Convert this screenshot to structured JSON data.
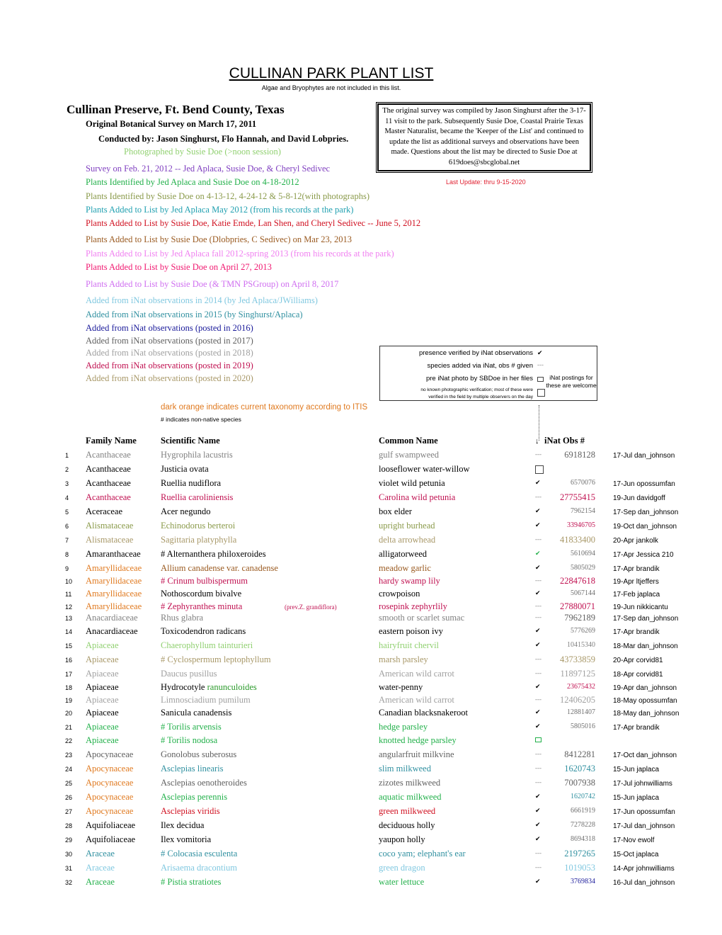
{
  "header": {
    "title": "CULLINAN PARK PLANT LIST",
    "subtitle": "Algae and Bryophytes are not included in this list.",
    "location": "Cullinan Preserve, Ft. Bend County, Texas",
    "original_survey": "Original Botanical Survey on March 17, 2011",
    "conducted_by": "Conducted by: Jason Singhurst, Flo Hannah, and David Lobpries.",
    "photographed_by": "Photographed by Susie Doe (>noon session)",
    "survey_2012": "Survey on Feb. 21, 2012 -- Jed Aplaca, Susie Doe, & Cheryl Sedivec"
  },
  "info_box": "The original survey was compiled by Jason Singhurst after the 3-17-11 visit to the park.   Subsequently Susie Doe, Coastal Prairie Texas Master Naturalist, became the 'Keeper of the List' and continued to update the list as additional surveys and observations have been made.   Questions about the list may be directed to Susie Doe at 619does@sbcglobal.net",
  "last_update": "Last Update: thru 9-15-2020",
  "color_key": [
    {
      "text": "Plants Identified by Jed Aplaca and Susie Doe on 4-18-2012",
      "color": "#22b04a"
    },
    {
      "text": "Plants Identified by Susie Doe on 4-13-12, 4-24-12 & 5-8-12(with photographs)",
      "color": "#8a9a4a"
    },
    {
      "text": "Plants Added to List by Jed Aplaca May 2012 (from his records at the park)",
      "color": "#20a0b0"
    },
    {
      "text": "Plants Added to List by Susie Doe, Katie Emde, Lan Shen, and Cheryl Sedivec -- June 5, 2012",
      "color": "#d01020"
    },
    {
      "text": "Plants Added to List by Susie Doe (Dlobpries, C Sedivec) on Mar 23, 2013",
      "color": "#9a5a20"
    },
    {
      "text": "Plants Added to List by Jed Aplaca fall 2012-spring 2013  (from his records at the park)",
      "color": "#f080f0"
    },
    {
      "text": "Plants Added to List by Susie Doe on April 27, 2013",
      "color": "#f01870"
    },
    {
      "text": "Plants Added to List by Susie Doe (& TMN PSGroup) on April 8, 2017",
      "color": "#d070f0"
    },
    {
      "text": "Added from iNat observations    in 2014 (by Jed Aplaca/JWilliams)",
      "color": "#80c8e0"
    },
    {
      "text": "Added from iNat observations    in 2015 (by Singhurst/Aplaca)",
      "color": "#3090a0"
    },
    {
      "text": "Added from iNat observations  (posted in 2016)",
      "color": "#1a1a9a"
    },
    {
      "text": "Added from iNat observations  (posted in 2017)",
      "color": "#606060"
    },
    {
      "text": "Added from iNat observations  (posted in 2018)",
      "color": "#a0a0a0"
    },
    {
      "text": "Added from iNat observations  (posted in 2019)",
      "color": "#c01050"
    },
    {
      "text": "Added from iNat observations  (posted in 2020)",
      "color": "#a89868"
    }
  ],
  "legend": {
    "verified": "presence verified by iNat observations",
    "added_via_inat": "species added via iNat, obs # given",
    "pre_inat_photo": "pre iNat photo by SBDoe in her files",
    "no_verification_1": "no known photographic verification; most of these were",
    "no_verification_2": "verified in the field by multiple observers on the day",
    "welcome": "iNat postings for these are welcome",
    "check_symbol": "✔",
    "dash_symbol": "---"
  },
  "notes": {
    "dark_orange": "dark orange indicates current taxonomy according to ITIS",
    "non_native": "# indicates non-native species"
  },
  "table": {
    "headers": {
      "family": "Family Name",
      "scientific": "Scientific Name",
      "common": "Common Name",
      "arrow": "↓",
      "obs": "iNat Obs #"
    },
    "rows": [
      {
        "n": "1",
        "family": "Acanthaceae",
        "scientific": "Hygrophila lacustris",
        "prev": "",
        "common": "gulf swampweed",
        "mark": "dash",
        "obs": "6918128",
        "date": "17-Jul",
        "user": "dan_johnson",
        "famColor": "#808080",
        "sciColor": "#808080",
        "comColor": "#808080",
        "obsColor": "#606060",
        "obsSize": "big"
      },
      {
        "n": "2",
        "family": "Acanthaceae",
        "scientific": "Justicia ovata",
        "prev": "",
        "common": "looseflower water-willow",
        "mark": "box",
        "obs": "",
        "date": "",
        "user": "",
        "famColor": "#000",
        "sciColor": "#000",
        "comColor": "#000",
        "obsColor": "#000",
        "obsSize": "big"
      },
      {
        "n": "3",
        "family": "Acanthaceae",
        "scientific": "Ruellia nudiflora",
        "prev": "",
        "common": "violet wild petunia",
        "mark": "check",
        "obs": "6570076",
        "date": "17-Jun",
        "user": "opossumfan",
        "famColor": "#000",
        "sciColor": "#000",
        "comColor": "#000",
        "obsColor": "#707070",
        "obsSize": "small"
      },
      {
        "n": "4",
        "family": "Acanthaceae",
        "scientific": "Ruellia caroliniensis",
        "prev": "",
        "common": "Carolina wild petunia",
        "mark": "dash",
        "obs": "27755415",
        "date": "19-Jun",
        "user": "davidgoff",
        "famColor": "#c01050",
        "sciColor": "#c01050",
        "comColor": "#c01050",
        "obsColor": "#c01050",
        "obsSize": "big"
      },
      {
        "n": "5",
        "family": "Aceraceae",
        "scientific": "Acer negundo",
        "prev": "",
        "common": "box elder",
        "mark": "check",
        "obs": "7962154",
        "date": "17-Sep",
        "user": "dan_johnson",
        "famColor": "#000",
        "sciColor": "#000",
        "comColor": "#000",
        "obsColor": "#707070",
        "obsSize": "small"
      },
      {
        "n": "6",
        "family": "Alismataceae",
        "scientific": "Echinodorus berteroi",
        "prev": "",
        "common": "upright burhead",
        "mark": "check",
        "obs": "33946705",
        "date": "19-Oct",
        "user": "dan_johnson",
        "famColor": "#8a9a4a",
        "sciColor": "#8a9a4a",
        "comColor": "#8a9a4a",
        "obsColor": "#c01050",
        "obsSize": "small"
      },
      {
        "n": "7",
        "family": "Alismataceae",
        "scientific": "Sagittaria platyphylla",
        "prev": "",
        "common": "delta arrowhead",
        "mark": "dash",
        "obs": "41833400",
        "date": "20-Apr",
        "user": "jankolk",
        "famColor": "#a89868",
        "sciColor": "#a89868",
        "comColor": "#a89868",
        "obsColor": "#a89868",
        "obsSize": "big"
      },
      {
        "n": "8",
        "family": "Amaranthaceae",
        "scientific": "# Alternanthera philoxeroides",
        "prev": "",
        "common": "alligatorweed",
        "mark": "check-green",
        "obs": "5610694",
        "date": "17-Apr",
        "user": "Jessica 210",
        "famColor": "#000",
        "sciColor": "#000",
        "comColor": "#000",
        "obsColor": "#707070",
        "obsSize": "small"
      },
      {
        "n": "9",
        "family": "Amaryllidaceae",
        "scientific": "Allium canadense var. canadense",
        "prev": "",
        "common": "meadow garlic",
        "mark": "check",
        "obs": "5805029",
        "date": "17-Apr",
        "user": "brandik",
        "famColor": "#e07a20",
        "sciColor": "#9a5a20",
        "comColor": "#9a5a20",
        "obsColor": "#707070",
        "obsSize": "small"
      },
      {
        "n": "10",
        "family": "Amaryllidaceae",
        "scientific": "# Crinum bulbispermum",
        "prev": "",
        "common": "hardy swamp lily",
        "mark": "dash",
        "obs": "22847618",
        "date": "19-Apr",
        "user": "ltjeffers",
        "famColor": "#e07a20",
        "sciColor": "#c01050",
        "comColor": "#c01050",
        "obsColor": "#c01050",
        "obsSize": "big"
      },
      {
        "n": "11",
        "family": "Amaryllidaceae",
        "scientific": "Nothoscordum bivalve",
        "prev": "",
        "common": "crowpoison",
        "mark": "check",
        "obs": "5067144",
        "date": "17-Feb",
        "user": "japlaca",
        "famColor": "#e07a20",
        "sciColor": "#000",
        "comColor": "#000",
        "obsColor": "#707070",
        "obsSize": "small"
      },
      {
        "n": "12",
        "family": "Amaryllidaceae",
        "scientific": "# Zephyranthes minuta",
        "prev": "(prev.Z. grandiflora)",
        "common": "rosepink zephyrlily",
        "mark": "dash",
        "obs": "27880071",
        "date": "19-Jun",
        "user": "nikkicantu",
        "famColor": "#e07a20",
        "sciColor": "#c01050",
        "comColor": "#c01050",
        "obsColor": "#c01050",
        "obsSize": "big"
      },
      {
        "n": "13",
        "family": "Anacardiaceae",
        "scientific": "Rhus glabra",
        "prev": "",
        "common": "smooth or scarlet sumac",
        "mark": "dash",
        "obs": "7962189",
        "date": "17-Sep",
        "user": "dan_johnson",
        "famColor": "#808080",
        "sciColor": "#808080",
        "comColor": "#808080",
        "obsColor": "#606060",
        "obsSize": "big"
      },
      {
        "n": "14",
        "family": "Anacardiaceae",
        "scientific": "Toxicodendron radicans",
        "prev": "",
        "common": "eastern poison ivy",
        "mark": "check",
        "obs": "5776269",
        "date": "17-Apr",
        "user": "brandik",
        "famColor": "#000",
        "sciColor": "#000",
        "comColor": "#000",
        "obsColor": "#707070",
        "obsSize": "small"
      },
      {
        "n": "15",
        "family": "Apiaceae",
        "scientific": "Chaerophyllum tainturieri",
        "prev": "",
        "common": "hairyfruit chervil",
        "mark": "check",
        "obs": "10415340",
        "date": "18-Mar",
        "user": "dan_johnson",
        "famColor": "#90d070",
        "sciColor": "#90d070",
        "comColor": "#90d070",
        "obsColor": "#808080",
        "obsSize": "small"
      },
      {
        "n": "16",
        "family": "Apiaceae",
        "scientific": "# Cyclospermum leptophyllum",
        "prev": "",
        "common": "marsh parsley",
        "mark": "dash",
        "obs": "43733859",
        "date": "20-Apr",
        "user": "corvid81",
        "famColor": "#a89868",
        "sciColor": "#a89868",
        "comColor": "#a89868",
        "obsColor": "#a89868",
        "obsSize": "big"
      },
      {
        "n": "17",
        "family": "Apiaceae",
        "scientific": "Daucus pusillus",
        "prev": "",
        "common": "American wild carrot",
        "mark": "dash",
        "obs": "11897125",
        "date": "18-Apr",
        "user": "corvid81",
        "famColor": "#a0a0a0",
        "sciColor": "#a0a0a0",
        "comColor": "#a0a0a0",
        "obsColor": "#a0a0a0",
        "obsSize": "big"
      },
      {
        "n": "18",
        "family": "Apiaceae",
        "scientific": "Hydrocotyle ",
        "sciExtra": "ranunculoides",
        "prev": "",
        "common": "water-penny",
        "mark": "check",
        "obs": "23675432",
        "date": "19-Apr",
        "user": "dan_johnson",
        "famColor": "#000",
        "sciColor": "#000",
        "sciExtraColor": "#2a9a2a",
        "comColor": "#000",
        "obsColor": "#c01050",
        "obsSize": "small"
      },
      {
        "n": "19",
        "family": "Apiaceae",
        "scientific": "Limnosciadium pumilum",
        "prev": "",
        "common": "American wild carrot",
        "mark": "dash",
        "obs": "12406205",
        "date": "18-May",
        "user": "opossumfan",
        "famColor": "#a0a0a0",
        "sciColor": "#a0a0a0",
        "comColor": "#a0a0a0",
        "obsColor": "#a0a0a0",
        "obsSize": "big"
      },
      {
        "n": "20",
        "family": "Apiaceae",
        "scientific": "Sanicula canadensis",
        "prev": "",
        "common": "Canadian blacksnakeroot",
        "mark": "check",
        "obs": "12881407",
        "date": "18-May",
        "user": "dan_johnson",
        "famColor": "#000",
        "sciColor": "#000",
        "comColor": "#000",
        "obsColor": "#707070",
        "obsSize": "small"
      },
      {
        "n": "21",
        "family": "Apiaceae",
        "scientific": "# Torilis arvensis",
        "prev": "",
        "common": "hedge parsley",
        "mark": "check",
        "obs": "5805016",
        "date": "17-Apr",
        "user": "brandik",
        "famColor": "#22b04a",
        "sciColor": "#22b04a",
        "comColor": "#22b04a",
        "obsColor": "#707070",
        "obsSize": "small"
      },
      {
        "n": "22",
        "family": "Apiaceae",
        "scientific": "# Torilis nodosa",
        "prev": "",
        "common": "knotted hedge parsley",
        "mark": "photo",
        "obs": "",
        "date": "",
        "user": "",
        "famColor": "#22b04a",
        "sciColor": "#22b04a",
        "comColor": "#22b04a",
        "obsColor": "#000",
        "obsSize": "big"
      },
      {
        "n": "23",
        "family": "Apocynaceae",
        "scientific": "Gonolobus suberosus",
        "prev": "",
        "common": "angularfruit milkvine",
        "mark": "dash",
        "obs": "8412281",
        "date": "17-Oct",
        "user": "dan_johnson",
        "famColor": "#606060",
        "sciColor": "#606060",
        "comColor": "#606060",
        "obsColor": "#606060",
        "obsSize": "big"
      },
      {
        "n": "24",
        "family": "Apocynaceae",
        "scientific": "Asclepias linearis",
        "prev": "",
        "common": "slim milkweed",
        "mark": "dash",
        "obs": "1620743",
        "date": "15-Jun",
        "user": "japlaca",
        "famColor": "#e07a20",
        "sciColor": "#3090a0",
        "comColor": "#3090a0",
        "obsColor": "#3090a0",
        "obsSize": "big"
      },
      {
        "n": "25",
        "family": "Apocynaceae",
        "scientific": "Asclepias oenotheroides",
        "prev": "",
        "common": "zizotes milkweed",
        "mark": "dash",
        "obs": "7007938",
        "date": "17-Jul",
        "user": "johnwilliams",
        "famColor": "#e07a20",
        "sciColor": "#606060",
        "comColor": "#606060",
        "obsColor": "#606060",
        "obsSize": "big"
      },
      {
        "n": "26",
        "family": "Apocynaceae",
        "scientific": "Asclepias perennis",
        "prev": "",
        "common": "aquatic milkweed",
        "mark": "check",
        "obs": "1620742",
        "date": "15-Jun",
        "user": "japlaca",
        "famColor": "#e07a20",
        "sciColor": "#22b04a",
        "comColor": "#22b04a",
        "obsColor": "#3090a0",
        "obsSize": "small"
      },
      {
        "n": "27",
        "family": "Apocynaceae",
        "scientific": "Asclepias viridis",
        "prev": "",
        "common": "green milkweed",
        "mark": "check",
        "obs": "6661919",
        "date": "17-Jun",
        "user": "opossumfan",
        "famColor": "#e07a20",
        "sciColor": "#d01020",
        "comColor": "#d01020",
        "obsColor": "#707070",
        "obsSize": "small"
      },
      {
        "n": "28",
        "family": "Aquifoliaceae",
        "scientific": "Ilex decidua",
        "prev": "",
        "common": "deciduous holly",
        "mark": "check",
        "obs": "7278228",
        "date": "17-Jul",
        "user": "dan_johnson",
        "famColor": "#000",
        "sciColor": "#000",
        "comColor": "#000",
        "obsColor": "#707070",
        "obsSize": "small"
      },
      {
        "n": "29",
        "family": "Aquifoliaceae",
        "scientific": "Ilex vomitoria",
        "prev": "",
        "common": "yaupon holly",
        "mark": "check",
        "obs": "8694318",
        "date": "17-Nov",
        "user": "ewolf",
        "famColor": "#000",
        "sciColor": "#000",
        "comColor": "#000",
        "obsColor": "#707070",
        "obsSize": "small"
      },
      {
        "n": "30",
        "family": "Araceae",
        "scientific": "# Colocasia esculenta",
        "prev": "",
        "common": "coco yam;  elephant's ear",
        "mark": "dash",
        "obs": "2197265",
        "date": "15-Oct",
        "user": "japlaca",
        "famColor": "#3090a0",
        "sciColor": "#3090a0",
        "comColor": "#3090a0",
        "obsColor": "#3090a0",
        "obsSize": "big"
      },
      {
        "n": "31",
        "family": "Araceae",
        "scientific": "Arisaema dracontium",
        "prev": "",
        "common": "green dragon",
        "mark": "dash",
        "obs": "1019053",
        "date": "14-Apr",
        "user": "johnwilliams",
        "famColor": "#80c8e0",
        "sciColor": "#80c8e0",
        "comColor": "#80c8e0",
        "obsColor": "#80c8e0",
        "obsSize": "big"
      },
      {
        "n": "32",
        "family": "Araceae",
        "scientific": "# Pistia stratiotes",
        "prev": "",
        "common": "water lettuce",
        "mark": "check",
        "obs": "3769834",
        "date": "16-Jul",
        "user": "dan_johnson",
        "famColor": "#22b04a",
        "sciColor": "#22b04a",
        "comColor": "#22b04a",
        "obsColor": "#1a1a9a",
        "obsSize": "small"
      }
    ]
  }
}
